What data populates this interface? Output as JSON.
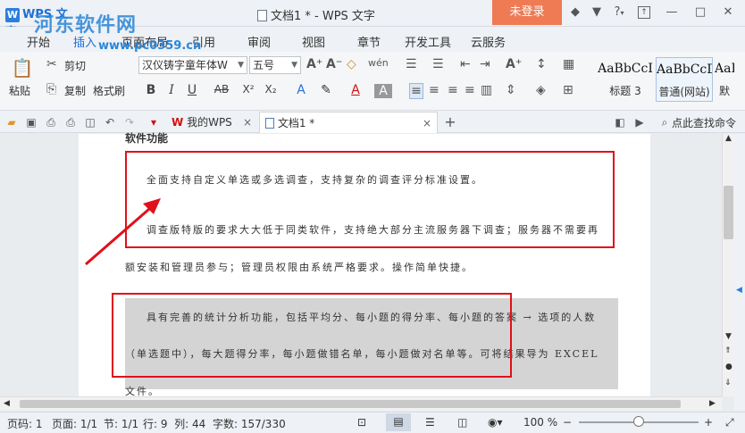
{
  "title_bar": {
    "app_name": "WPS 文字",
    "watermark_main": "河东软件网",
    "watermark_sub": "www.pc0359.cn",
    "document_title": "文档1 * - WPS 文字",
    "login_label": "未登录",
    "help_glyph": "?"
  },
  "menu": {
    "tabs": [
      "开始",
      "插入",
      "页面布局",
      "引用",
      "审阅",
      "视图",
      "章节",
      "开发工具",
      "云服务"
    ]
  },
  "ribbon": {
    "paste_label": "粘贴",
    "cut_label": "剪切",
    "copy_label": "复制",
    "format_painter_label": "格式刷",
    "font_name": "汉仪铸字童年体W",
    "font_size": "五号",
    "styles": [
      {
        "sample": "AaBbCcI",
        "name": "标题 3"
      },
      {
        "sample": "AaBbCcD",
        "name": "普通(网站)"
      },
      {
        "sample": "AaBl",
        "name": "默"
      }
    ]
  },
  "tabstrip": {
    "tab_mywps": "我的WPS",
    "tab_doc": "文档1 *",
    "search_label": "点此查找命令"
  },
  "document": {
    "heading_partial": "软件功能",
    "lines": [
      "全面支持自定义单选或多选调查，支持复杂的调查评分标准设置。",
      "调查版特版的要求大大低于同类软件，支持绝大部分主流服务器下调查；服务器不需要再",
      "额安装和管理员参与；管理员权限由系统严格要求。操作简单快捷。",
      "具有完善的统计分析功能，包括平均分、每小题的得分率、每小题的答案 → 选项的人数",
      "（单选题中），每大题得分率，每小题做错名单，每小题做对名单等。可将结果导为 EXCEL",
      "文件。"
    ]
  },
  "status": {
    "page_no": "页码: 1",
    "pages": "页面: 1/1",
    "section": "节: 1/1",
    "position": "行: 9  列: 44",
    "word_count": "字数: 157/330",
    "zoom": "100 %",
    "zoom_fraction": 0.5
  },
  "colors": {
    "accent": "#1e6fd9",
    "login_bg": "#ee7b54",
    "annotation_red": "#e0101a"
  }
}
